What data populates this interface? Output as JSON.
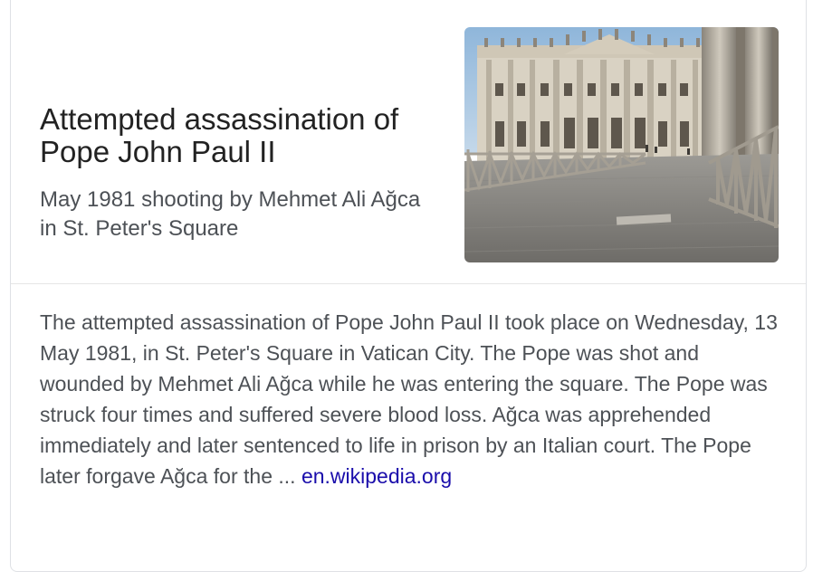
{
  "panel": {
    "title": "Attempted assassination of Pope John Paul II",
    "subtitle": "May 1981 shooting by Mehmet Ali Ağca in St. Peter's Square",
    "image_icon": "photo-st-peters-basilica",
    "description": "The attempted assassination of Pope John Paul II took place on Wednesday, 13 May 1981, in St. Peter's Square in Vatican City. The Pope was shot and wounded by Mehmet Ali Ağca while he was entering the square. The Pope was struck four times and suffered severe blood loss. Ağca was apprehended immediately and later sentenced to life in prison by an Italian court. The Pope later forgave Ağca for the ...",
    "source_link": "en.wikipedia.org",
    "colors": {
      "title": "#222222",
      "text": "#4d5156",
      "link": "#1a0dab",
      "border": "#dfe1e5"
    }
  }
}
